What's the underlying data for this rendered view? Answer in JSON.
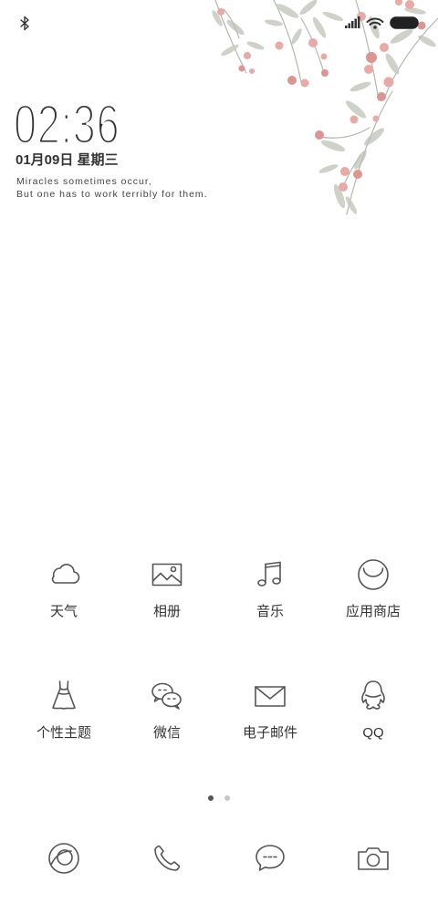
{
  "status_bar": {
    "left_icons": [
      "bluetooth-icon"
    ],
    "right_icons": [
      "signal-icon",
      "wifi-icon",
      "battery-icon"
    ]
  },
  "lock_widget": {
    "time": "02:36",
    "date": "01月09日 星期三",
    "quote_line1": "Miracles sometimes occur,",
    "quote_line2": "But one has to work terribly for them."
  },
  "apps": [
    {
      "label": "天气",
      "icon": "weather-cloud-icon"
    },
    {
      "label": "相册",
      "icon": "gallery-icon"
    },
    {
      "label": "音乐",
      "icon": "music-note-icon"
    },
    {
      "label": "应用商店",
      "icon": "app-store-icon"
    },
    {
      "label": "个性主题",
      "icon": "dress-theme-icon"
    },
    {
      "label": "微信",
      "icon": "wechat-icon"
    },
    {
      "label": "电子邮件",
      "icon": "envelope-icon"
    },
    {
      "label": "QQ",
      "icon": "qq-penguin-icon"
    }
  ],
  "page_indicator": {
    "count": 2,
    "active_index": 0
  },
  "dock": [
    {
      "icon": "browser-icon"
    },
    {
      "icon": "phone-icon"
    },
    {
      "icon": "messages-icon"
    },
    {
      "icon": "camera-icon"
    }
  ],
  "wallpaper": {
    "decoration": "watercolor-berry-branches"
  },
  "colors": {
    "background": "#ffffff",
    "text": "#333333",
    "icon_stroke": "#555555",
    "berry": "#e9a9a4",
    "leaf": "#c6cabf",
    "indicator_active": "#555555",
    "indicator_inactive": "#c8c8c8"
  }
}
